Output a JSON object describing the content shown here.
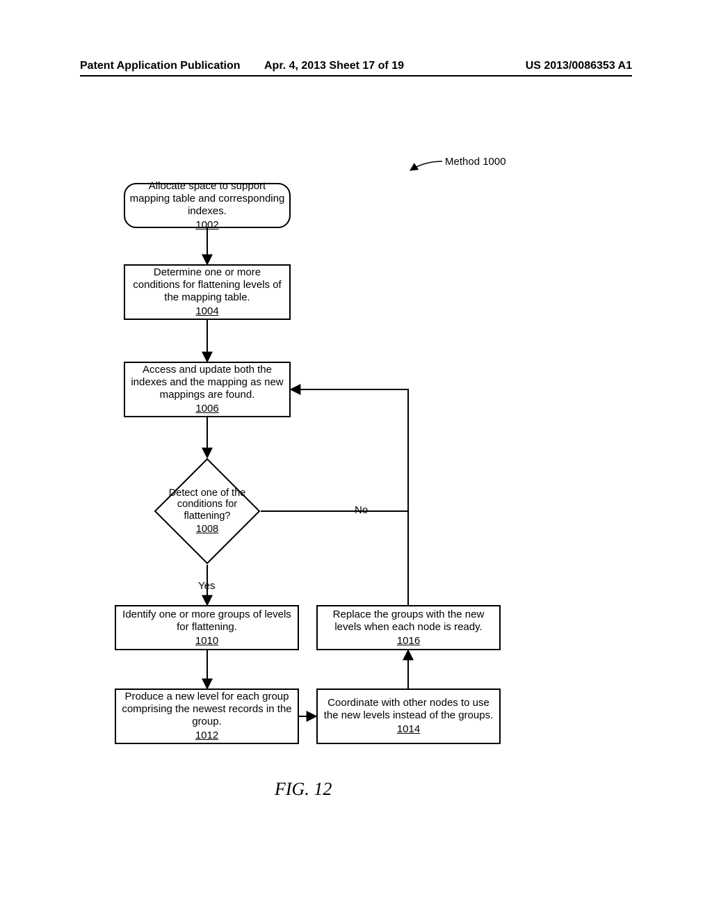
{
  "header": {
    "left": "Patent Application Publication",
    "center": "Apr. 4, 2013  Sheet 17 of 19",
    "right": "US 2013/0086353 A1"
  },
  "method_label": "Method 1000",
  "steps": {
    "s1002": {
      "text": "Allocate space to support mapping table and corresponding indexes.",
      "num": "1002"
    },
    "s1004": {
      "text": "Determine one or more conditions for flattening levels of the mapping table.",
      "num": "1004"
    },
    "s1006": {
      "text": "Access and update both the indexes and the mapping as new mappings are found.",
      "num": "1006"
    },
    "s1008": {
      "text": "Detect one of the conditions for flattening?",
      "num": "1008"
    },
    "s1010": {
      "text": "Identify one or more groups of levels for flattening.",
      "num": "1010"
    },
    "s1012": {
      "text": "Produce a new level for each group comprising the newest records in the group.",
      "num": "1012"
    },
    "s1014": {
      "text": "Coordinate with other nodes to use the new levels instead of the groups.",
      "num": "1014"
    },
    "s1016": {
      "text": "Replace the groups with the new levels when each node is ready.",
      "num": "1016"
    }
  },
  "branches": {
    "yes": "Yes",
    "no": "No"
  },
  "figure_caption": "FIG. 12",
  "chart_data": {
    "type": "flowchart",
    "title": "Method 1000",
    "nodes": [
      {
        "id": "1002",
        "shape": "terminator",
        "label": "Allocate space to support mapping table and corresponding indexes."
      },
      {
        "id": "1004",
        "shape": "process",
        "label": "Determine one or more conditions for flattening levels of the mapping table."
      },
      {
        "id": "1006",
        "shape": "process",
        "label": "Access and update both the indexes and the mapping as new mappings are found."
      },
      {
        "id": "1008",
        "shape": "decision",
        "label": "Detect one of the conditions for flattening?"
      },
      {
        "id": "1010",
        "shape": "process",
        "label": "Identify one or more groups of levels for flattening."
      },
      {
        "id": "1012",
        "shape": "process",
        "label": "Produce a new level for each group comprising the newest records in the group."
      },
      {
        "id": "1014",
        "shape": "process",
        "label": "Coordinate with other nodes to use the new levels instead of the groups."
      },
      {
        "id": "1016",
        "shape": "process",
        "label": "Replace the groups with the new levels when each node is ready."
      }
    ],
    "edges": [
      {
        "from": "1002",
        "to": "1004"
      },
      {
        "from": "1004",
        "to": "1006"
      },
      {
        "from": "1006",
        "to": "1008"
      },
      {
        "from": "1008",
        "to": "1010",
        "label": "Yes"
      },
      {
        "from": "1008",
        "to": "1006",
        "label": "No"
      },
      {
        "from": "1010",
        "to": "1012"
      },
      {
        "from": "1012",
        "to": "1014"
      },
      {
        "from": "1014",
        "to": "1016"
      },
      {
        "from": "1016",
        "to": "1006"
      }
    ]
  }
}
